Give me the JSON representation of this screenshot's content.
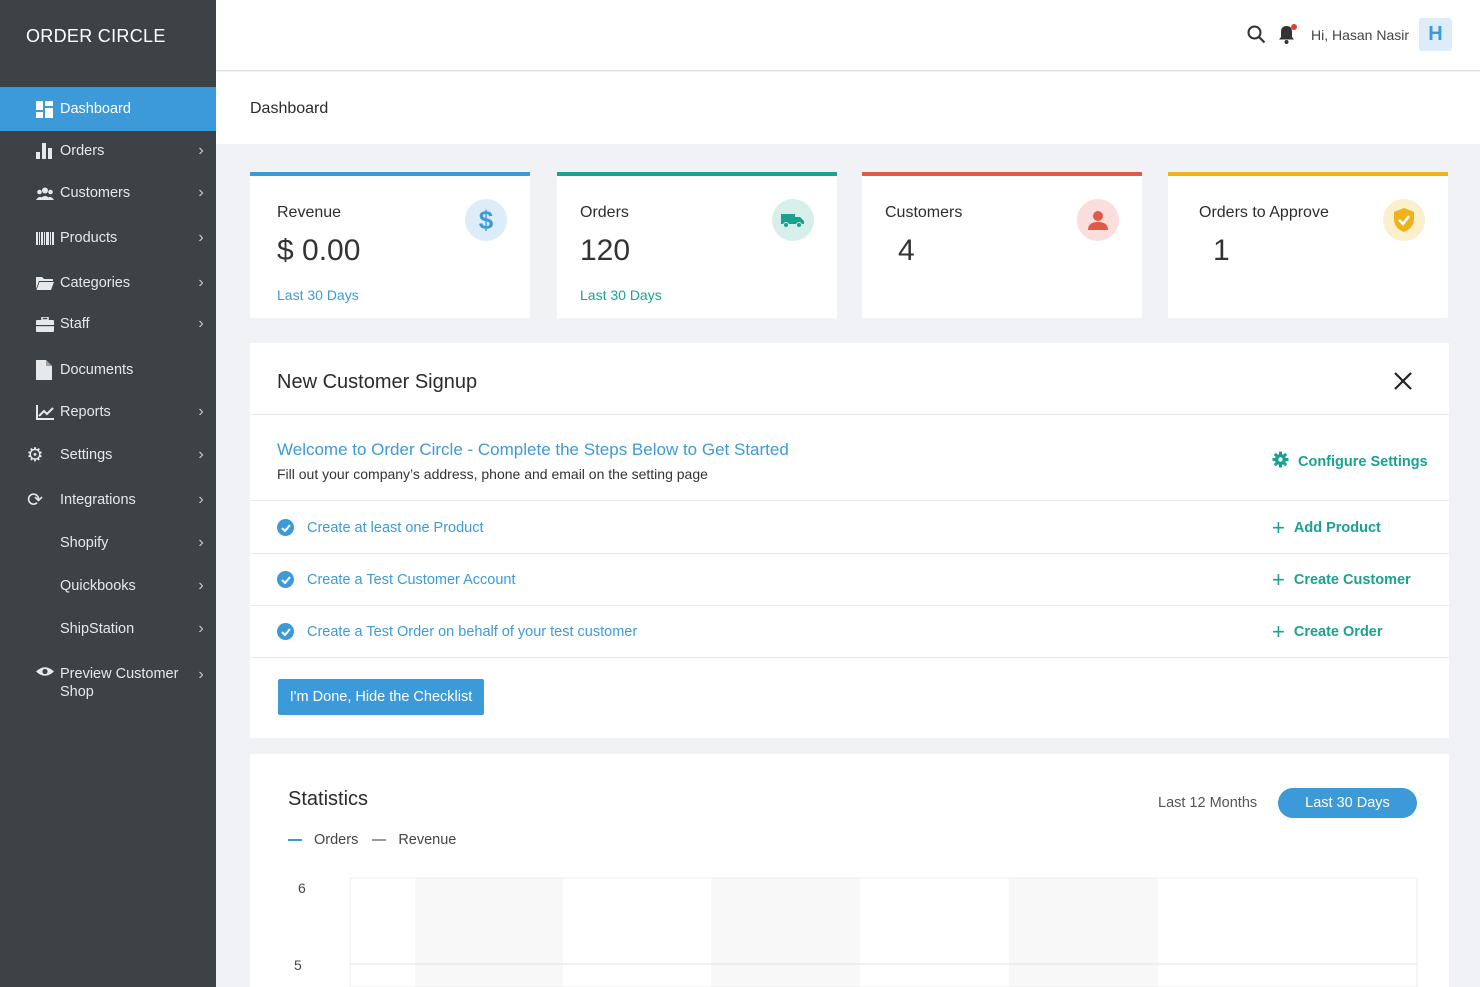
{
  "app": {
    "brand": "ORDER CIRCLE"
  },
  "sidebar": {
    "items": [
      {
        "label": "Dashboard",
        "icon": "dashboard-icon",
        "active": true,
        "chevron": false
      },
      {
        "label": "Orders",
        "icon": "bar-chart-icon",
        "chevron": true
      },
      {
        "label": "Customers",
        "icon": "users-icon",
        "chevron": true
      },
      {
        "label": "Products",
        "icon": "barcode-icon",
        "chevron": true
      },
      {
        "label": "Categories",
        "icon": "folder-icon",
        "chevron": true
      },
      {
        "label": "Staff",
        "icon": "briefcase-icon",
        "chevron": true
      },
      {
        "label": "Documents",
        "icon": "document-icon",
        "chevron": false
      },
      {
        "label": "Reports",
        "icon": "line-chart-icon",
        "chevron": true
      },
      {
        "label": "Settings",
        "icon": "gear-icon",
        "chevron": true
      },
      {
        "label": "Integrations",
        "icon": "sync-icon",
        "chevron": true
      },
      {
        "label": "Shopify",
        "icon": "",
        "chevron": true
      },
      {
        "label": "Quickbooks",
        "icon": "",
        "chevron": true
      },
      {
        "label": "ShipStation",
        "icon": "",
        "chevron": true
      },
      {
        "label": "Preview Customer Shop",
        "icon": "eye-icon",
        "chevron": true
      }
    ]
  },
  "topbar": {
    "greeting": "Hi, Hasan Nasir",
    "avatar_letter": "H"
  },
  "page": {
    "title": "Dashboard"
  },
  "cards": [
    {
      "title": "Revenue",
      "value": "$ 0.00",
      "sub": "Last 30 Days",
      "color": "#3d9ad8",
      "icon": "dollar-icon"
    },
    {
      "title": "Orders",
      "value": "120",
      "sub": "Last 30 Days",
      "color": "#1aa28f",
      "icon": "truck-icon"
    },
    {
      "title": "Customers",
      "value": "4",
      "sub": "",
      "color": "#e05a47",
      "icon": "user-icon"
    },
    {
      "title": "Orders to Approve",
      "value": "1",
      "sub": "",
      "color": "#f0b21a",
      "icon": "shield-check-icon"
    }
  ],
  "signup": {
    "title": "New Customer Signup",
    "welcome": "Welcome to Order Circle - Complete the Steps Below to Get Started",
    "welcome_sub": "Fill out your company’s address, phone and email on the setting page",
    "configure_label": "Configure Settings",
    "steps": [
      {
        "label": "Create at least one Product",
        "action": "Add Product"
      },
      {
        "label": "Create a Test Customer Account",
        "action": "Create Customer"
      },
      {
        "label": "Create a Test Order on behalf of your test customer",
        "action": "Create Order"
      }
    ],
    "done_button": "I'm Done, Hide the Checklist"
  },
  "statistics": {
    "title": "Statistics",
    "range_options": [
      "Last 12 Months",
      "Last 30 Days"
    ],
    "active_range": "Last 30 Days",
    "legend": [
      {
        "name": "Orders",
        "color": "#3d9ad8"
      },
      {
        "name": "Revenue",
        "color": "#9a9a9a"
      }
    ],
    "y_ticks": [
      "6",
      "5"
    ]
  },
  "colors": {
    "accent": "#3d9ad8",
    "success": "#1aa28f",
    "sidebar_bg": "#3d4247"
  }
}
